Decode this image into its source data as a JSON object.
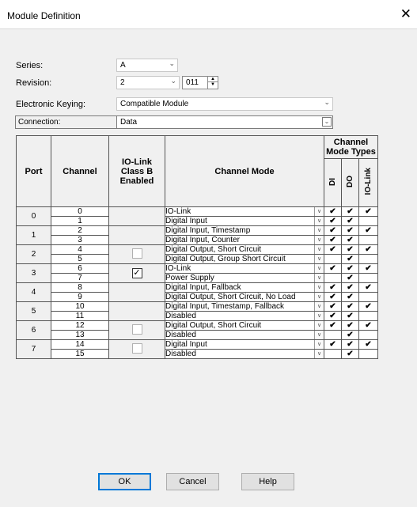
{
  "window": {
    "title": "Module Definition",
    "close_icon": "close-icon"
  },
  "fields": {
    "series_label": "Series:",
    "series_value": "A",
    "revision_label": "Revision:",
    "revision_value": "2",
    "revision_minor": "011",
    "keying_label": "Electronic Keying:",
    "keying_value": "Compatible Module",
    "connection_label": "Connection:",
    "connection_value": "Data"
  },
  "table": {
    "headers": {
      "port": "Port",
      "channel": "Channel",
      "iolink": "IO-Link Class B Enabled",
      "mode": "Channel Mode",
      "types": "Channel Mode Types",
      "di": "DI",
      "do": "DO",
      "iol": "IO-Link"
    },
    "ports": [
      {
        "port": "0",
        "class_b": "none",
        "channels": [
          {
            "ch": "0",
            "mode": "IO-Link",
            "di": "✔",
            "do": "✔",
            "iol": "✔"
          },
          {
            "ch": "1",
            "mode": "Digital Input",
            "di": "✔",
            "do": "✔",
            "iol": ""
          }
        ]
      },
      {
        "port": "1",
        "class_b": "none",
        "channels": [
          {
            "ch": "2",
            "mode": "Digital Input, Timestamp",
            "di": "✔",
            "do": "✔",
            "iol": "✔"
          },
          {
            "ch": "3",
            "mode": "Digital Input, Counter",
            "di": "✔",
            "do": "✔",
            "iol": ""
          }
        ]
      },
      {
        "port": "2",
        "class_b": "unchecked",
        "channels": [
          {
            "ch": "4",
            "mode": "Digital Output, Short Circuit",
            "di": "✔",
            "do": "✔",
            "iol": "✔"
          },
          {
            "ch": "5",
            "mode": "Digital Output, Group Short Circuit",
            "di": "",
            "do": "✔",
            "iol": ""
          }
        ]
      },
      {
        "port": "3",
        "class_b": "checked",
        "channels": [
          {
            "ch": "6",
            "mode": "IO-Link",
            "di": "✔",
            "do": "✔",
            "iol": "✔"
          },
          {
            "ch": "7",
            "mode": "Power Supply",
            "di": "",
            "do": "✔",
            "iol": ""
          }
        ]
      },
      {
        "port": "4",
        "class_b": "none",
        "channels": [
          {
            "ch": "8",
            "mode": "Digital Input, Fallback",
            "di": "✔",
            "do": "✔",
            "iol": "✔"
          },
          {
            "ch": "9",
            "mode": "Digital Output, Short Circuit, No Load",
            "di": "✔",
            "do": "✔",
            "iol": ""
          }
        ]
      },
      {
        "port": "5",
        "class_b": "none",
        "channels": [
          {
            "ch": "10",
            "mode": "Digital Input, Timestamp, Fallback",
            "di": "✔",
            "do": "✔",
            "iol": "✔"
          },
          {
            "ch": "11",
            "mode": "Disabled",
            "di": "✔",
            "do": "✔",
            "iol": ""
          }
        ]
      },
      {
        "port": "6",
        "class_b": "unchecked",
        "channels": [
          {
            "ch": "12",
            "mode": "Digital Output, Short Circuit",
            "di": "✔",
            "do": "✔",
            "iol": "✔"
          },
          {
            "ch": "13",
            "mode": "Disabled",
            "di": "",
            "do": "✔",
            "iol": ""
          }
        ]
      },
      {
        "port": "7",
        "class_b": "unchecked",
        "channels": [
          {
            "ch": "14",
            "mode": "Digital Input",
            "di": "✔",
            "do": "✔",
            "iol": "✔"
          },
          {
            "ch": "15",
            "mode": "Disabled",
            "di": "",
            "do": "✔",
            "iol": ""
          }
        ]
      }
    ]
  },
  "buttons": {
    "ok": "OK",
    "cancel": "Cancel",
    "help": "Help"
  }
}
